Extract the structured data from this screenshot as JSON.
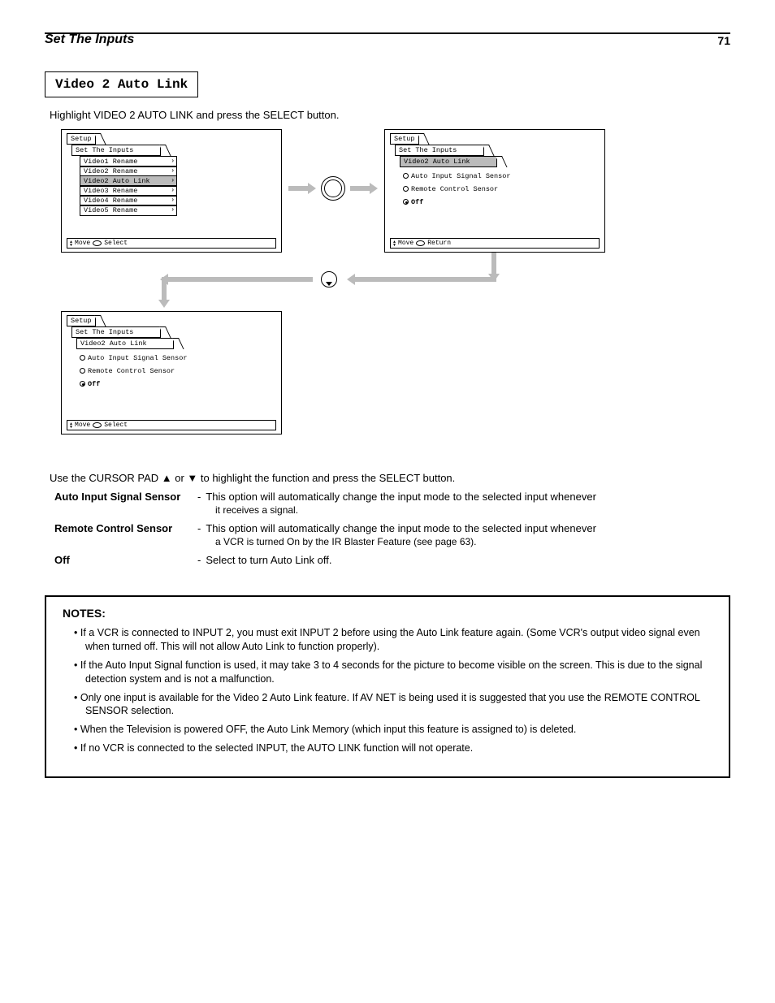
{
  "header": {
    "title": "Set The Inputs",
    "page": "71"
  },
  "section": {
    "title": "Video 2 Auto Link"
  },
  "intro": "Highlight VIDEO 2 AUTO LINK and press the SELECT button.",
  "instruction_line": "Use the CURSOR PAD ▲ or ▼ to highlight the function and press the SELECT button.",
  "options": {
    "ais": {
      "label": "Auto Input Signal Sensor",
      "desc": "This option will automatically change the input mode to the selected input whenever",
      "desc2": "it receives a signal."
    },
    "rcs": {
      "label": "Remote Control Sensor",
      "desc": "This option will automatically change the input mode to the selected input whenever",
      "desc2": "a VCR is turned On by the IR Blaster Feature (see page 63)."
    },
    "off": {
      "label": "Off",
      "desc": "Select to turn Auto Link off."
    }
  },
  "menus": {
    "setup": "Setup",
    "set_inputs": "Set The Inputs",
    "auto_link": "Video2 Auto Link",
    "items": [
      "Video1 Rename",
      "Video2 Rename",
      "Video2 Auto Link",
      "Video3 Rename",
      "Video4 Rename",
      "Video5 Rename"
    ],
    "radios": {
      "ais": "Auto Input Signal Sensor",
      "rcs": "Remote Control Sensor",
      "off": "Off"
    },
    "footer_move": "Move",
    "footer_select": "Select",
    "footer_return": "Return"
  },
  "notes": {
    "title": "NOTES:",
    "items": [
      "If a VCR is connected to INPUT 2, you must exit INPUT 2 before using the Auto Link feature again. (Some VCR's output video signal even when turned off. This will not allow Auto Link to function properly).",
      "If the Auto Input Signal function is used, it may take 3 to 4 seconds for the picture to become visible on the screen. This is due to the signal detection system and is not a malfunction.",
      "Only one input is available for the Video 2 Auto Link feature. If AV NET is being used it is suggested that you use the REMOTE CONTROL SENSOR selection.",
      "When the Television is powered OFF, the Auto Link Memory (which input this feature is assigned to) is deleted.",
      "If no VCR is connected to the selected INPUT, the AUTO LINK function will not operate."
    ]
  }
}
